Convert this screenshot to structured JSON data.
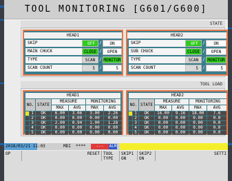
{
  "title": "TOOL MONITORING [G601/G600]",
  "state_section": {
    "label": "STATE",
    "head1": {
      "title": "HEAD1",
      "rows": [
        {
          "label": "SKIP",
          "a": "OFF",
          "b": "ON"
        },
        {
          "label": "MAIN CHUCK",
          "a": "CLOSE",
          "b": "OPEN"
        },
        {
          "label": "TYPE",
          "a": "SCAN",
          "b": "MONITOR"
        },
        {
          "label": "SCAN COUNT",
          "a": "5",
          "b": "5"
        }
      ]
    },
    "head2": {
      "title": "HEAD2",
      "rows": [
        {
          "label": "SKIP",
          "a": "OFF",
          "b": "ON"
        },
        {
          "label": "SUB CHUCK",
          "a": "CLOSE",
          "b": "OPEN"
        },
        {
          "label": "TYPE",
          "a": "SCAN",
          "b": "MONITOR"
        },
        {
          "label": "SCAN COUNT",
          "a": "5",
          "b": "5"
        }
      ]
    },
    "separator": "/"
  },
  "tool_load": {
    "label": "TOOL LOAD",
    "head1": {
      "title": "HEAD1",
      "col_no": "NO.",
      "col_state": "STATE",
      "col_measure": "MEASURE",
      "col_monitoring": "MONITORING",
      "col_max": "MAX",
      "col_avg": "AVG",
      "rows": [
        {
          "no": "1",
          "state": "OK",
          "m_max": "6.00",
          "m_avg": "3.06",
          "mon_max": "3.00",
          "mon_avg": "2.26"
        },
        {
          "no": "2",
          "state": "OK",
          "m_max": "0.00",
          "m_avg": "0.00",
          "mon_max": "0.00",
          "mon_avg": "0.00"
        },
        {
          "no": "3",
          "state": "OK",
          "m_max": "2.00",
          "m_avg": "0.94",
          "mon_max": "1.00",
          "mon_avg": "1.28"
        },
        {
          "no": "4",
          "state": "OK",
          "m_max": "0.00",
          "m_avg": "0.00",
          "mon_max": "0.00",
          "mon_avg": "0.00"
        },
        {
          "no": "5",
          "state": "OK",
          "m_max": "0.00",
          "m_avg": "0.00",
          "mon_max": "0.00",
          "mon_avg": "0.00"
        }
      ]
    },
    "head2": {
      "title": "HEAD2",
      "col_no": "NO.",
      "col_state": "STATE",
      "col_measure": "MEASURE",
      "col_monitoring": "MONITORING",
      "col_max": "MAX",
      "col_avg": "AVG",
      "rows": [
        {
          "no": "1",
          "state": "OK",
          "m_max": "16.00",
          "m_avg": "9.16",
          "mon_max": "18.00",
          "mon_avg": "7.6"
        },
        {
          "no": "2",
          "state": "OK",
          "m_max": "0.00",
          "m_avg": "0.00",
          "mon_max": "0.00",
          "mon_avg": "0.0"
        },
        {
          "no": "3",
          "state": "OK",
          "m_max": "0.00",
          "m_avg": "0.00",
          "mon_max": "0.00",
          "mon_avg": "0.0"
        },
        {
          "no": "4",
          "state": "OK",
          "m_max": "0.00",
          "m_avg": "0.00",
          "mon_max": "0.00",
          "mon_avg": "0.0"
        },
        {
          "no": "5",
          "state": "OK",
          "m_max": "0.00",
          "m_avg": "0.00",
          "mon_max": "0.00",
          "mon_avg": "0.0"
        }
      ]
    }
  },
  "status": {
    "datetime": "2018/03/21 11:03",
    "mode": "MDI",
    "stars": "****",
    "dashes": "---",
    "alarm": "ALM"
  },
  "softkeys": {
    "op": "OP",
    "reset": "RESET",
    "tool_type": "TOOL TYPE",
    "skip1": "SKIP1 ON",
    "skip2": "SKIP2 ON",
    "setting": "SETTI"
  },
  "colors": {
    "panel_teal": "#3a7d8c",
    "border_orange": "#e8794a",
    "active_green": "#2fcb1e",
    "selected_yellow": "#f4e21b",
    "status_bar_yellow": "#f4ef2a",
    "alarm_red": "#e03a3a",
    "alarm_blue": "#2d56c8"
  }
}
